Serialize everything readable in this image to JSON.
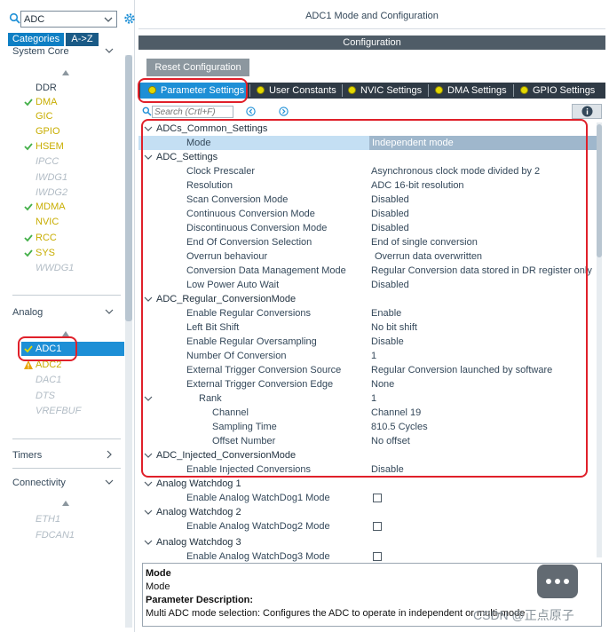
{
  "left_panel": {
    "search_value": "ADC",
    "tabs": [
      "Categories",
      "A->Z"
    ],
    "system_core": {
      "label": "System Core",
      "items": [
        {
          "label": "DDR",
          "state": "plain"
        },
        {
          "label": "DMA",
          "state": "enabled"
        },
        {
          "label": "GIC",
          "state": "plain"
        },
        {
          "label": "GPIO",
          "state": "plain"
        },
        {
          "label": "HSEM",
          "state": "enabled"
        },
        {
          "label": "IPCC",
          "state": "disabled"
        },
        {
          "label": "IWDG1",
          "state": "disabled"
        },
        {
          "label": "IWDG2",
          "state": "disabled"
        },
        {
          "label": "MDMA",
          "state": "enabled"
        },
        {
          "label": "NVIC",
          "state": "plain"
        },
        {
          "label": "RCC",
          "state": "enabled"
        },
        {
          "label": "SYS",
          "state": "enabled"
        },
        {
          "label": "WWDG1",
          "state": "disabled"
        }
      ]
    },
    "analog": {
      "label": "Analog",
      "items": [
        {
          "label": "ADC1",
          "state": "selected"
        },
        {
          "label": "ADC2",
          "state": "warning"
        },
        {
          "label": "DAC1",
          "state": "disabled"
        },
        {
          "label": "DTS",
          "state": "disabled"
        },
        {
          "label": "VREFBUF",
          "state": "disabled"
        }
      ]
    },
    "timers": {
      "label": "Timers"
    },
    "connectivity": {
      "label": "Connectivity",
      "items": [
        {
          "label": "ETH1",
          "state": "disabled"
        },
        {
          "label": "FDCAN1",
          "state": "disabled"
        }
      ]
    }
  },
  "right_panel": {
    "title": "ADC1 Mode and Configuration",
    "config_label": "Configuration",
    "reset_label": "Reset Configuration",
    "tabs": [
      "Parameter Settings",
      "User Constants",
      "NVIC Settings",
      "DMA Settings",
      "GPIO Settings"
    ],
    "search_placeholder": "Search (Crtl+F)",
    "tree": [
      {
        "name": "ADCs_Common_Settings",
        "value": "",
        "kind": "group"
      },
      {
        "name": "Mode",
        "value": "Independent mode",
        "kind": "param"
      },
      {
        "name": "ADC_Settings",
        "value": "",
        "kind": "group"
      },
      {
        "name": "Clock Prescaler",
        "value": "Asynchronous clock mode divided by 2",
        "kind": "param"
      },
      {
        "name": "Resolution",
        "value": "ADC 16-bit resolution",
        "kind": "param"
      },
      {
        "name": "Scan Conversion Mode",
        "value": "Disabled",
        "kind": "param"
      },
      {
        "name": "Continuous Conversion Mode",
        "value": "Disabled",
        "kind": "param"
      },
      {
        "name": "Discontinuous Conversion Mode",
        "value": "Disabled",
        "kind": "param"
      },
      {
        "name": "End Of Conversion Selection",
        "value": "End of single conversion",
        "kind": "param"
      },
      {
        "name": "Overrun behaviour",
        "value": "Overrun data overwritten",
        "kind": "param"
      },
      {
        "name": "Conversion Data Management Mode",
        "value": "Regular Conversion data stored in DR register only",
        "kind": "param"
      },
      {
        "name": "Low Power Auto Wait",
        "value": "Disabled",
        "kind": "param"
      },
      {
        "name": "ADC_Regular_ConversionMode",
        "value": "",
        "kind": "group"
      },
      {
        "name": "Enable Regular Conversions",
        "value": "Enable",
        "kind": "param"
      },
      {
        "name": "Left Bit Shift",
        "value": "No bit shift",
        "kind": "param"
      },
      {
        "name": "Enable Regular Oversampling",
        "value": "Disable",
        "kind": "param"
      },
      {
        "name": "Number Of Conversion",
        "value": "1",
        "kind": "param"
      },
      {
        "name": "External Trigger Conversion Source",
        "value": "Regular Conversion launched by software",
        "kind": "param"
      },
      {
        "name": "External Trigger Conversion Edge",
        "value": "None",
        "kind": "param"
      },
      {
        "name": "Rank",
        "value": "1",
        "kind": "subgroup"
      },
      {
        "name": "Channel",
        "value": "Channel 19",
        "kind": "subparam"
      },
      {
        "name": "Sampling Time",
        "value": "810.5 Cycles",
        "kind": "subparam"
      },
      {
        "name": "Offset Number",
        "value": "No offset",
        "kind": "subparam"
      },
      {
        "name": "ADC_Injected_ConversionMode",
        "value": "",
        "kind": "group"
      },
      {
        "name": "Enable Injected Conversions",
        "value": "Disable",
        "kind": "param"
      },
      {
        "name": "Analog Watchdog 1",
        "value": "",
        "kind": "group"
      },
      {
        "name": "Enable Analog WatchDog1 Mode",
        "value": "",
        "kind": "check"
      },
      {
        "name": "Analog Watchdog 2",
        "value": "",
        "kind": "group"
      },
      {
        "name": "Enable Analog WatchDog2 Mode",
        "value": "",
        "kind": "check"
      },
      {
        "name": "Analog Watchdog 3",
        "value": "",
        "kind": "group"
      },
      {
        "name": "Enable Analog WatchDog3 Mode",
        "value": "",
        "kind": "check"
      }
    ],
    "description": {
      "heading": "Mode",
      "name": "Mode",
      "param_desc_label": "Parameter Description:",
      "text": "Multi ADC mode selection: Configures the ADC to operate in independent or multi-mode"
    }
  },
  "watermark": "CSDN @正点原子",
  "colors": {
    "accent": "#1d8fd6",
    "enabled_text": "#c8ad00",
    "highlight_box": "#e0202a",
    "dark_bar": "#2f3a45"
  }
}
